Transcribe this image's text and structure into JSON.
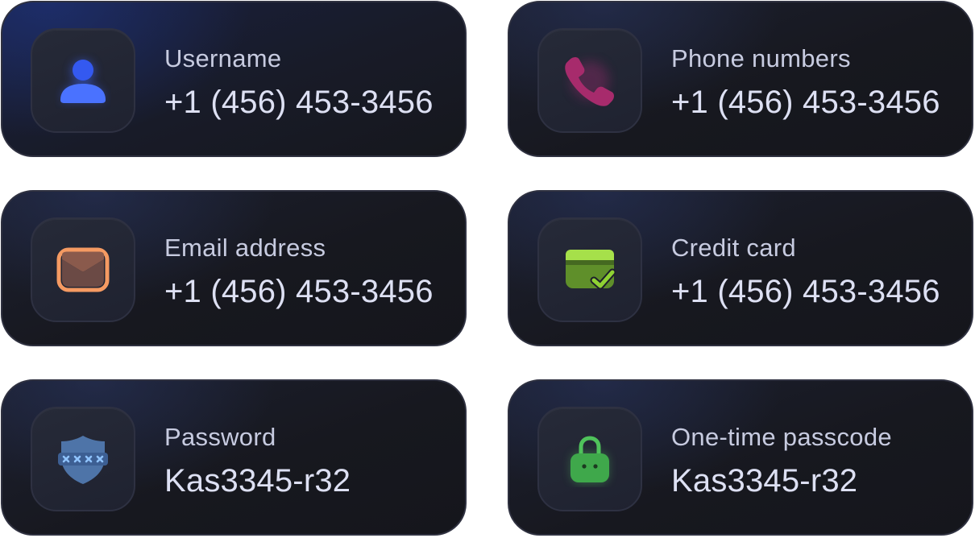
{
  "cards": [
    {
      "label": "Username",
      "value": "+1 (456) 453-3456",
      "icon": "user-icon",
      "icon_color": "#3f66ff"
    },
    {
      "label": "Phone numbers",
      "value": "+1 (456) 453-3456",
      "icon": "phone-icon",
      "icon_color": "#b2306f"
    },
    {
      "label": "Email address",
      "value": "+1 (456) 453-3456",
      "icon": "envelope-icon",
      "icon_color": "#f59a62"
    },
    {
      "label": "Credit card",
      "value": "+1 (456) 453-3456",
      "icon": "credit-card-check-icon",
      "icon_color": "#8fd233"
    },
    {
      "label": "Password",
      "value": "Kas3345-r32",
      "icon": "shield-password-icon",
      "icon_color": "#5b90d6"
    },
    {
      "label": "One-time passcode",
      "value": "Kas3345-r32",
      "icon": "padlock-icon",
      "icon_color": "#4fc25b"
    }
  ]
}
